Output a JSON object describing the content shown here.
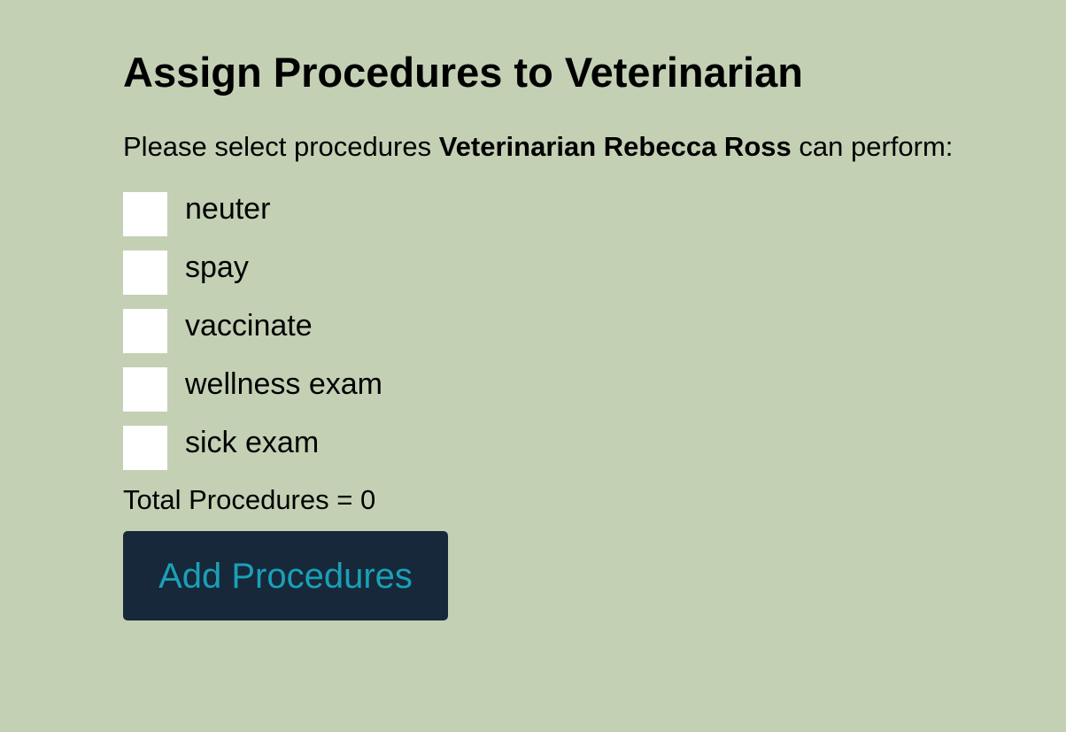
{
  "page": {
    "title": "Assign Procedures to Veterinarian",
    "prompt_prefix": "Please select procedures ",
    "prompt_bold": "Veterinarian Rebecca Ross",
    "prompt_suffix": " can perform:"
  },
  "procedures": [
    {
      "label": "neuter",
      "checked": false
    },
    {
      "label": "spay",
      "checked": false
    },
    {
      "label": "vaccinate",
      "checked": false
    },
    {
      "label": "wellness exam",
      "checked": false
    },
    {
      "label": "sick exam",
      "checked": false
    }
  ],
  "summary": {
    "total_text": "Total Procedures = 0"
  },
  "actions": {
    "add_label": "Add Procedures"
  },
  "colors": {
    "background": "#c3d0b4",
    "button_bg": "#162839",
    "button_text": "#1aa0b8",
    "checkbox_bg": "#ffffff"
  }
}
